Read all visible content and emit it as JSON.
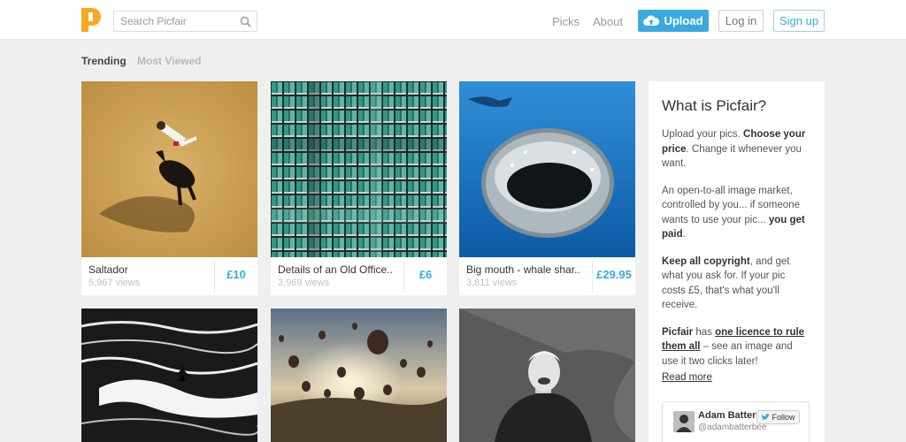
{
  "header": {
    "search_placeholder": "Search Picfair",
    "nav": [
      "Picks",
      "About"
    ],
    "upload_label": "Upload",
    "login_label": "Log in",
    "signup_label": "Sign up"
  },
  "tabs": {
    "trending": "Trending",
    "most_viewed": "Most Viewed"
  },
  "cards": [
    {
      "title": "Saltador",
      "views": "5,967 views",
      "price": "£10"
    },
    {
      "title": "Details of an Old Office..",
      "views": "3,969 views",
      "price": "£6"
    },
    {
      "title": "Big mouth - whale shar..",
      "views": "3,811 views",
      "price": "£29.95"
    }
  ],
  "sidebar": {
    "title": "What is Picfair?",
    "p1_a": "Upload your pics. ",
    "p1_b": "Choose your price",
    "p1_c": ". Change it whenever you want.",
    "p2_a": "An open-to-all image market, controlled by you... if someone wants to use your pic... ",
    "p2_b": "you get paid",
    "p2_c": ".",
    "p3_a": "Keep all copyright",
    "p3_b": ", and get what you ask for. If your pic costs £5, that's what you'll receive.",
    "p4_a": "Picfair",
    "p4_b": " has ",
    "p4_c": "one licence to rule them all",
    "p4_d": " – see an image and use it two clicks later!",
    "read_more": "Read more",
    "twitter_name": "Adam Batter",
    "twitter_handle": "@adambatterbee",
    "follow_label": "Follow"
  },
  "colors": {
    "accent": "#3aa9e0",
    "logo": "#f7a823"
  }
}
